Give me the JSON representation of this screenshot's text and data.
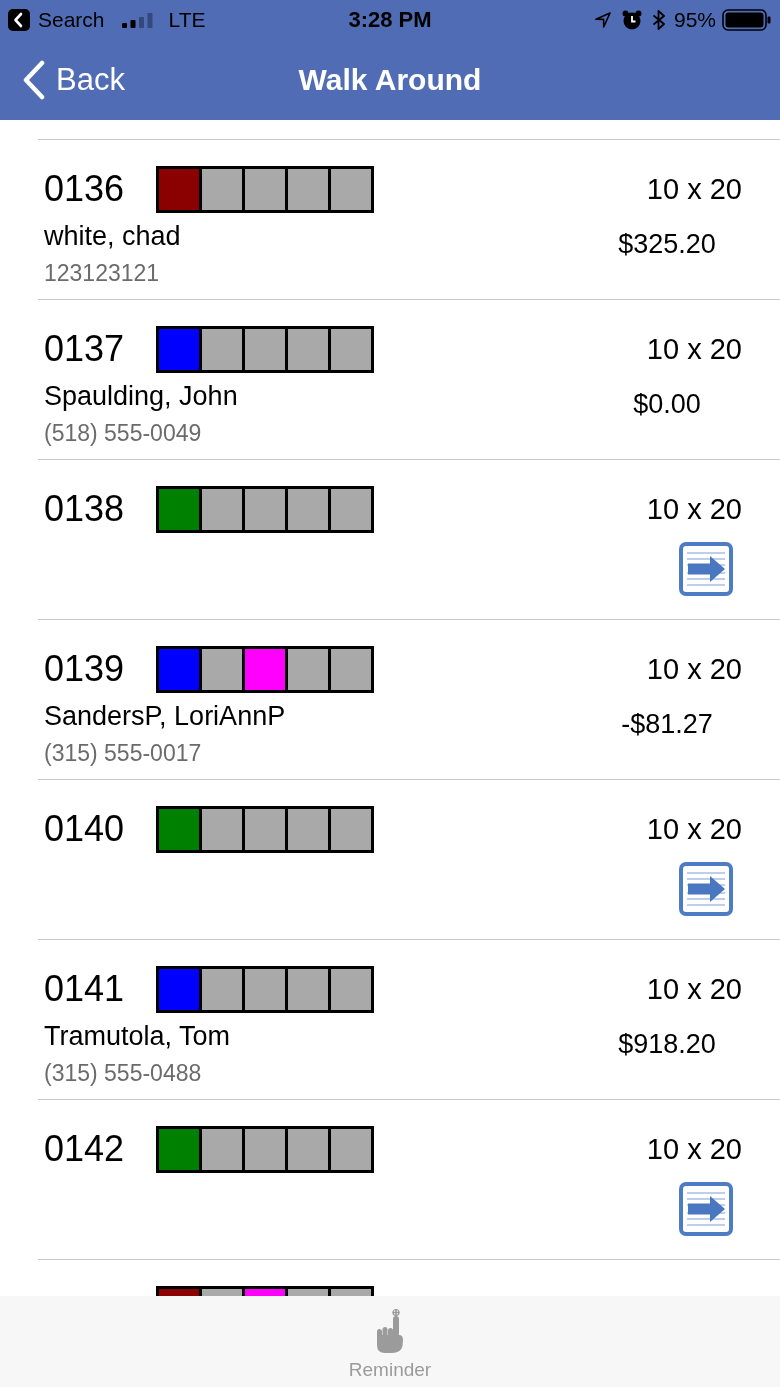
{
  "status_bar": {
    "back_app": "Search",
    "network": "LTE",
    "time": "3:28 PM",
    "battery": "95%"
  },
  "nav_bar": {
    "back": "Back",
    "title": "Walk Around"
  },
  "units": [
    {
      "kind": "occupied",
      "unit": "0136",
      "slots": [
        {
          "color": "#8b0000"
        },
        {
          "color": "#a9a9a9"
        },
        {
          "color": "#a9a9a9"
        },
        {
          "color": "#a9a9a9"
        },
        {
          "color": "#a9a9a9"
        }
      ],
      "size": "10 x 20",
      "tenant": "white, chad",
      "phone": "123123121",
      "balance": "$325.20"
    },
    {
      "kind": "occupied",
      "unit": "0137",
      "slots": [
        {
          "color": "#0000ff"
        },
        {
          "color": "#a9a9a9"
        },
        {
          "color": "#a9a9a9"
        },
        {
          "color": "#a9a9a9"
        },
        {
          "color": "#a9a9a9"
        }
      ],
      "size": "10 x 20",
      "tenant": "Spaulding, John",
      "phone": "(518) 555-0049",
      "balance": "$0.00"
    },
    {
      "kind": "vacant",
      "unit": "0138",
      "slots": [
        {
          "color": "#008000"
        },
        {
          "color": "#a9a9a9"
        },
        {
          "color": "#a9a9a9"
        },
        {
          "color": "#a9a9a9"
        },
        {
          "color": "#a9a9a9"
        }
      ],
      "size": "10 x 20"
    },
    {
      "kind": "occupied",
      "unit": "0139",
      "slots": [
        {
          "color": "#0000ff"
        },
        {
          "color": "#a9a9a9"
        },
        {
          "color": "#ff00ff"
        },
        {
          "color": "#a9a9a9"
        },
        {
          "color": "#a9a9a9"
        }
      ],
      "size": "10 x 20",
      "tenant": "SandersP, LoriAnnP",
      "phone": "(315) 555-0017",
      "balance": "-$81.27"
    },
    {
      "kind": "vacant",
      "unit": "0140",
      "slots": [
        {
          "color": "#008000"
        },
        {
          "color": "#a9a9a9"
        },
        {
          "color": "#a9a9a9"
        },
        {
          "color": "#a9a9a9"
        },
        {
          "color": "#a9a9a9"
        }
      ],
      "size": "10 x 20"
    },
    {
      "kind": "occupied",
      "unit": "0141",
      "slots": [
        {
          "color": "#0000ff"
        },
        {
          "color": "#a9a9a9"
        },
        {
          "color": "#a9a9a9"
        },
        {
          "color": "#a9a9a9"
        },
        {
          "color": "#a9a9a9"
        }
      ],
      "size": "10 x 20",
      "tenant": "Tramutola, Tom",
      "phone": "(315) 555-0488",
      "balance": "$918.20"
    },
    {
      "kind": "vacant",
      "unit": "0142",
      "slots": [
        {
          "color": "#008000"
        },
        {
          "color": "#a9a9a9"
        },
        {
          "color": "#a9a9a9"
        },
        {
          "color": "#a9a9a9"
        },
        {
          "color": "#a9a9a9"
        }
      ],
      "size": "10 x 20"
    },
    {
      "kind": "cut_off",
      "slots": [
        {
          "color": "#8b0000"
        },
        {
          "color": "#a9a9a9"
        },
        {
          "color": "#ff00ff"
        },
        {
          "color": "#a9a9a9"
        },
        {
          "color": "#a9a9a9"
        }
      ]
    }
  ],
  "tab_bar": {
    "tabs": [
      {
        "label": "Reminder",
        "selected": false
      }
    ]
  }
}
